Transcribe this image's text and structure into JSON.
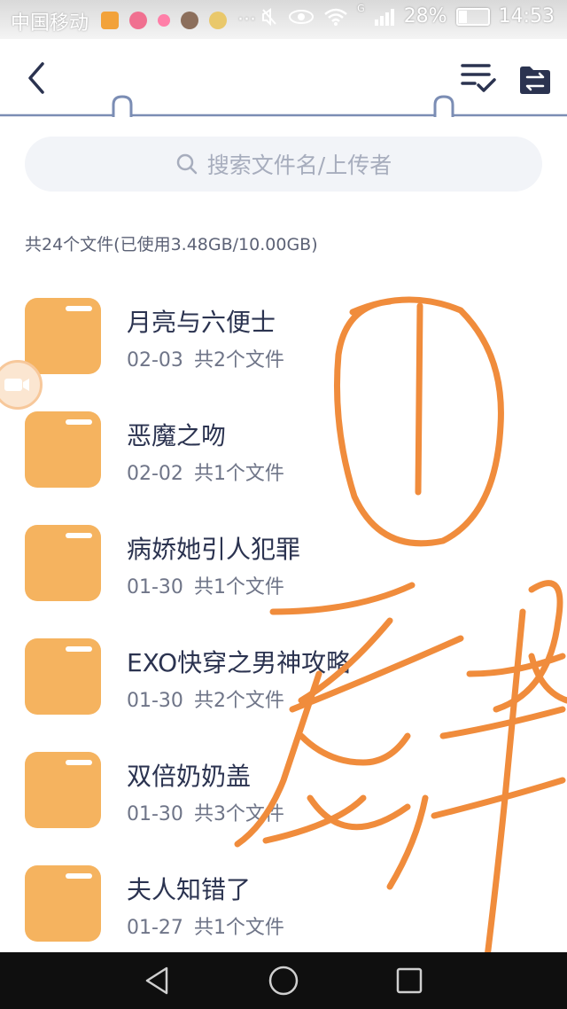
{
  "status_bar": {
    "carrier": "中国移动",
    "signal_label": "G",
    "battery": "28%",
    "battery_level": 0.28,
    "time": "14:53",
    "dots": "···"
  },
  "header": {
    "back_icon": "chevron-left-icon",
    "sort_icon": "sort-check-icon",
    "transfer_icon": "transfer-icon"
  },
  "search": {
    "placeholder": "搜索文件名/上传者",
    "icon": "search-icon"
  },
  "summary": "共24个文件(已使用3.48GB/10.00GB)",
  "files": [
    {
      "name": "月亮与六便士",
      "date": "02-03",
      "count": "共2个文件"
    },
    {
      "name": "恶魔之吻",
      "date": "02-02",
      "count": "共1个文件"
    },
    {
      "name": "病娇她引人犯罪",
      "date": "01-30",
      "count": "共1个文件"
    },
    {
      "name": "EXO快穿之男神攻略",
      "date": "01-30",
      "count": "共2个文件"
    },
    {
      "name": "双倍奶奶盖",
      "date": "01-30",
      "count": "共3个文件"
    },
    {
      "name": "夫人知错了",
      "date": "01-27",
      "count": "共1个文件"
    }
  ],
  "colors": {
    "accent": "#2b3350",
    "folder": "#f5b35f",
    "scribble": "#f08c3c",
    "header_line": "#7b8db4"
  },
  "nav": {
    "back": "triangle-back-icon",
    "home": "circle-home-icon",
    "recent": "square-recent-icon"
  }
}
